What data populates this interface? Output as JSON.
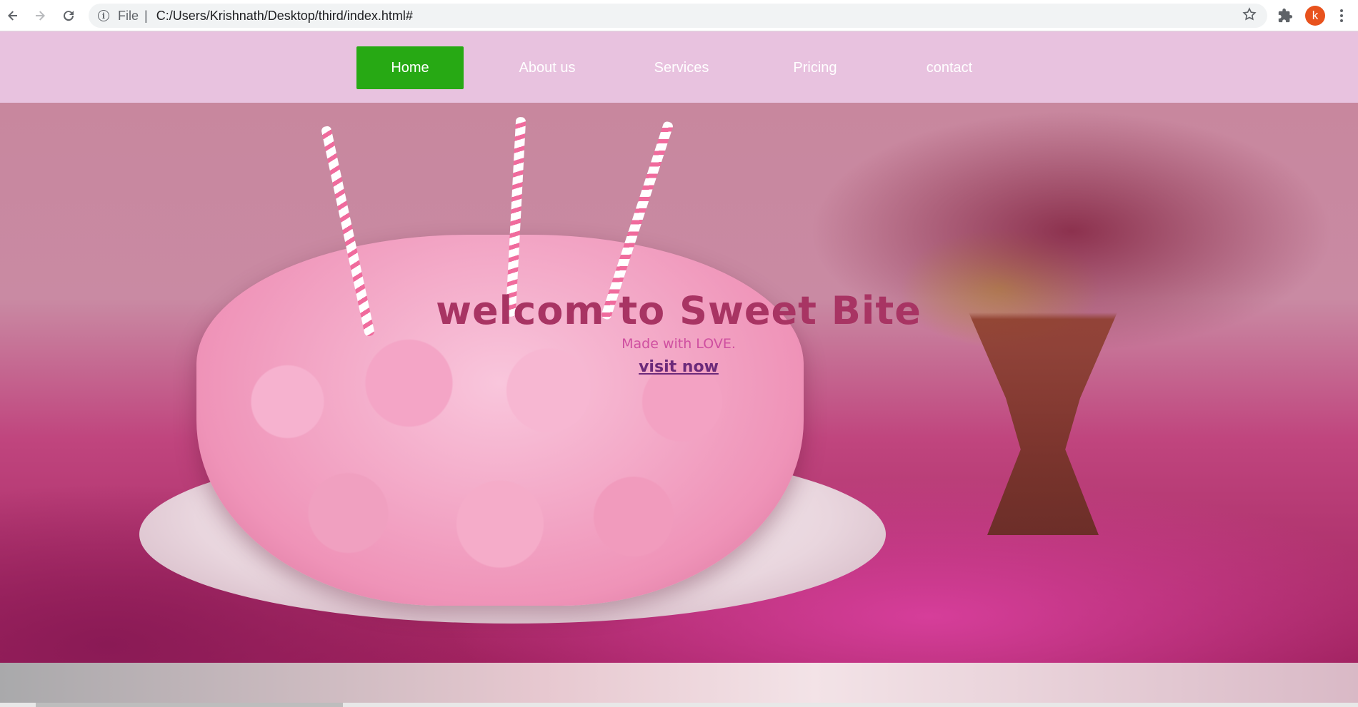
{
  "browser": {
    "file_label": "File",
    "separator": "|",
    "url": "C:/Users/Krishnath/Desktop/third/index.html#",
    "avatar_letter": "k",
    "icons": [
      "back-arrow-icon",
      "forward-arrow-icon",
      "reload-icon",
      "info-icon",
      "star-icon",
      "extensions-puzzle-icon",
      "kebab-menu-icon"
    ]
  },
  "nav": {
    "items": [
      {
        "label": "Home",
        "active": true
      },
      {
        "label": "About us",
        "active": false
      },
      {
        "label": "Services",
        "active": false
      },
      {
        "label": "Pricing",
        "active": false
      },
      {
        "label": "contact",
        "active": false
      }
    ],
    "background": "#e8c2df",
    "active_color": "#27a914"
  },
  "hero": {
    "title": "welcom to Sweet Bite",
    "subtitle": "Made with LOVE.",
    "link_label": "visit now",
    "title_color": "#a83463"
  }
}
